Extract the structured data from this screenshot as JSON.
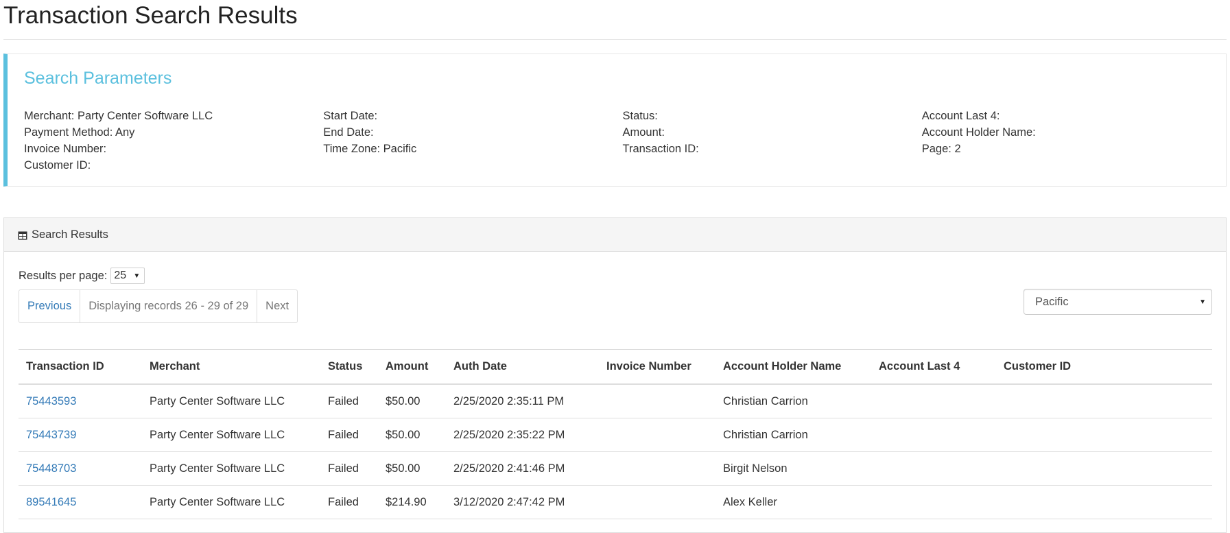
{
  "page": {
    "title": "Transaction Search Results"
  },
  "search_parameters": {
    "title": "Search Parameters",
    "columns": [
      [
        "Merchant: Party Center Software LLC",
        "Payment Method: Any",
        "Invoice Number:",
        "Customer ID:"
      ],
      [
        "Start Date:",
        "End Date:",
        "Time Zone: Pacific"
      ],
      [
        "Status:",
        "Amount:",
        "Transaction ID:"
      ],
      [
        "Account Last 4:",
        "Account Holder Name:",
        "Page: 2"
      ]
    ]
  },
  "results_panel": {
    "heading": "Search Results",
    "icon": "table-icon",
    "results_per_page_label": "Results per page:",
    "results_per_page_value": "25",
    "pager": {
      "previous": "Previous",
      "info": "Displaying records 26 - 29 of 29",
      "next": "Next"
    },
    "timezone_value": "Pacific",
    "columns": [
      "Transaction ID",
      "Merchant",
      "Status",
      "Amount",
      "Auth Date",
      "Invoice Number",
      "Account Holder Name",
      "Account Last 4",
      "Customer ID"
    ],
    "rows": [
      {
        "transaction_id": "75443593",
        "merchant": "Party Center Software LLC",
        "status": "Failed",
        "amount": "$50.00",
        "auth_date": "2/25/2020 2:35:11 PM",
        "invoice_number": "",
        "account_holder": "Christian Carrion",
        "account_last4": "",
        "customer_id": ""
      },
      {
        "transaction_id": "75443739",
        "merchant": "Party Center Software LLC",
        "status": "Failed",
        "amount": "$50.00",
        "auth_date": "2/25/2020 2:35:22 PM",
        "invoice_number": "",
        "account_holder": "Christian Carrion",
        "account_last4": "",
        "customer_id": ""
      },
      {
        "transaction_id": "75448703",
        "merchant": "Party Center Software LLC",
        "status": "Failed",
        "amount": "$50.00",
        "auth_date": "2/25/2020 2:41:46 PM",
        "invoice_number": "",
        "account_holder": "Birgit Nelson",
        "account_last4": "",
        "customer_id": ""
      },
      {
        "transaction_id": "89541645",
        "merchant": "Party Center Software LLC",
        "status": "Failed",
        "amount": "$214.90",
        "auth_date": "3/12/2020 2:47:42 PM",
        "invoice_number": "",
        "account_holder": "Alex Keller",
        "account_last4": "",
        "customer_id": ""
      }
    ]
  },
  "colors": {
    "accent": "#5bc0de",
    "link": "#337ab7",
    "border": "#dddddd",
    "muted": "#777777"
  }
}
